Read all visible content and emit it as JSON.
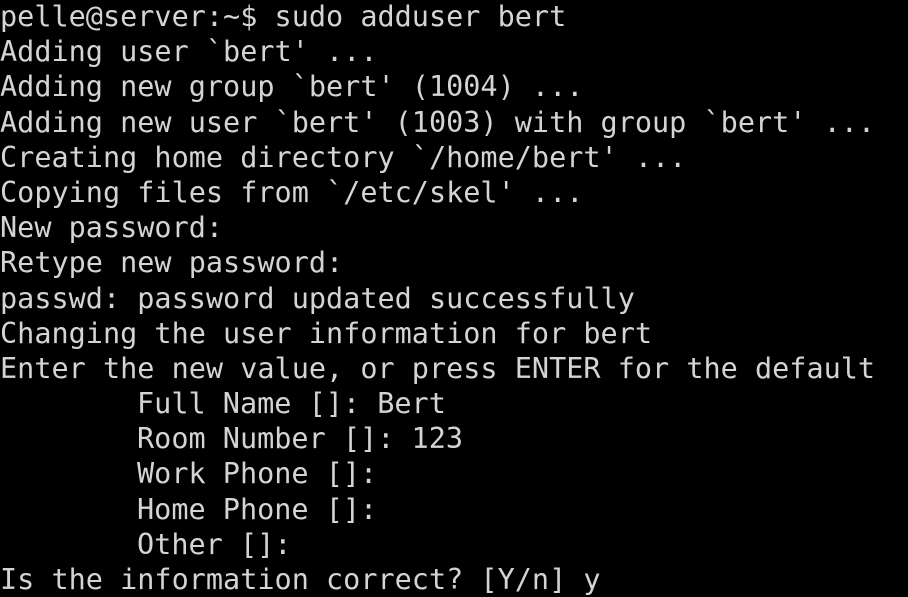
{
  "terminal": {
    "foreground": "#d4d4d4",
    "background": "#000000",
    "lines": [
      "pelle@server:~$ sudo adduser bert",
      "Adding user `bert' ...",
      "Adding new group `bert' (1004) ...",
      "Adding new user `bert' (1003) with group `bert' ...",
      "Creating home directory `/home/bert' ...",
      "Copying files from `/etc/skel' ...",
      "New password:",
      "Retype new password:",
      "passwd: password updated successfully",
      "Changing the user information for bert",
      "Enter the new value, or press ENTER for the default",
      "Full Name []: Bert",
      "Room Number []: 123",
      "Work Phone []:",
      "Home Phone []:",
      "Other []:",
      "Is the information correct? [Y/n] y"
    ]
  }
}
